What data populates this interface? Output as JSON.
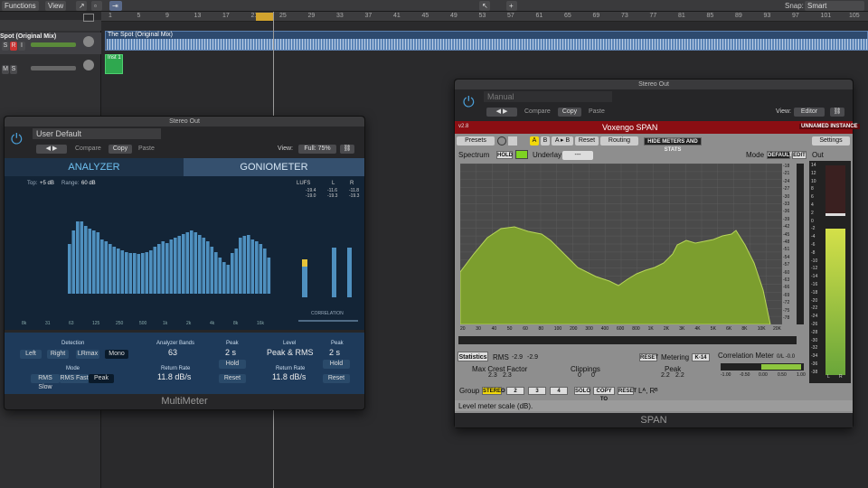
{
  "daw": {
    "menu_functions": "Functions",
    "menu_view": "View",
    "snap_label": "Snap:",
    "snap_value": "Smart",
    "ruler": [
      "1",
      "5",
      "9",
      "13",
      "17",
      "21",
      "25",
      "29",
      "33",
      "37",
      "41",
      "45",
      "49",
      "53",
      "57",
      "61",
      "65",
      "69",
      "73",
      "77",
      "81",
      "85",
      "89",
      "93",
      "97",
      "101",
      "105"
    ],
    "track1_name": "Spot (Original Mix)",
    "region1_label": "The Spot (Original Mix)",
    "region2_label": "Inst 1",
    "btn_s": "S",
    "btn_r": "R",
    "btn_i": "I",
    "btn_m": "M"
  },
  "multimeter": {
    "title": "Stereo Out",
    "preset": "User Default",
    "compare": "Compare",
    "copy": "Copy",
    "paste": "Paste",
    "view_label": "View:",
    "view_value": "Full: 75%",
    "tab_analyzer": "ANALYZER",
    "tab_goniometer": "GONIOMETER",
    "top_label": "Top:",
    "top_value": "+5 dB",
    "range_label": "Range:",
    "range_value": "60 dB",
    "lufs": "LUFS",
    "l": "L",
    "r": "R",
    "lufs_vals": "-19.4",
    "lufs_vals2": "-19.0",
    "l_peak": "-11.6",
    "l_rms": "-19.3",
    "r_peak": "-11.8",
    "r_rms": "-19.3",
    "peak_word": "Peak",
    "rms_word": "RMS",
    "correlation": "CORRELATION",
    "detection": "Detection",
    "det_left": "Left",
    "det_right": "Right",
    "det_lrmax": "LRmax",
    "det_mono": "Mono",
    "mode": "Mode",
    "mode_slow": "RMS Slow",
    "mode_fast": "RMS Fast",
    "mode_peak": "Peak",
    "bands_label": "Analyzer Bands",
    "bands_value": "63",
    "ret_label": "Return Rate",
    "ret_value": "11.8 dB/s",
    "peak_label": "Peak",
    "peak_value": "2 s",
    "hold": "Hold",
    "reset": "Reset",
    "level_label": "Level",
    "level_value": "Peak & RMS",
    "ret2_value": "11.8 dB/s",
    "peak2_value": "2 s",
    "footer": "MultiMeter",
    "freq_ticks": [
      "8k",
      "31",
      "63",
      "125",
      "250",
      "500",
      "1k",
      "2k",
      "4k",
      "8k",
      "16k"
    ]
  },
  "span": {
    "title": "Stereo Out",
    "preset": "Manual",
    "compare": "Compare",
    "copy": "Copy",
    "paste": "Paste",
    "view_label": "View:",
    "view_value": "Editor",
    "version": "v2.8",
    "name": "Voxengo SPAN",
    "instance": "UNNAMED INSTANCE",
    "presets": "Presets",
    "a": "A",
    "b": "B",
    "ab": "A ▸ B",
    "reset": "Reset",
    "routing": "Routing",
    "hide": "HIDE METERS AND STATS",
    "settings": "Settings",
    "spectrum": "Spectrum",
    "hold": "HOLD",
    "underlay": "Underlay",
    "underlay_val": "---",
    "mode": "Mode",
    "mode_default": "DEFAULT",
    "edit": "EDIT",
    "out": "Out",
    "db_scale": [
      "-18",
      "-21",
      "-24",
      "-27",
      "-30",
      "-33",
      "-36",
      "-39",
      "-42",
      "-45",
      "-48",
      "-51",
      "-54",
      "-57",
      "-60",
      "-63",
      "-66",
      "-69",
      "-72",
      "-75",
      "-78"
    ],
    "freq_scale": [
      "20",
      "30",
      "40",
      "50",
      "60",
      "80",
      "100",
      "200",
      "300",
      "400",
      "600",
      "800",
      "1K",
      "2K",
      "3K",
      "4K",
      "5K",
      "6K",
      "8K",
      "10K",
      "20K"
    ],
    "out_scale": [
      "14",
      "12",
      "10",
      "8",
      "6",
      "4",
      "2",
      "0",
      "-2",
      "-4",
      "-6",
      "-8",
      "-10",
      "-12",
      "-14",
      "-16",
      "-18",
      "-20",
      "-22",
      "-24",
      "-26",
      "-28",
      "-30",
      "-32",
      "-34",
      "-36",
      "-38"
    ],
    "statistics": "Statistics",
    "rms_label": "RMS",
    "rms_l": "-2.9",
    "rms_r": "-2.9",
    "crest_label": "Max Crest Factor",
    "crest_l": "2.3",
    "crest_r": "2.3",
    "clip_label": "Clippings",
    "clip_l": "0",
    "clip_r": "0",
    "reset_btn": "RESET",
    "metering": "Metering",
    "metering_val": "K-14",
    "peak_label": "Peak",
    "peak_l": "2.2",
    "peak_r": "2.2",
    "corr_label": "Correlation Meter",
    "corr_vals": "0/L  -0.0",
    "corr_ticks": [
      "-1.00",
      "-0.50",
      "0.00",
      "0.50",
      "1.00"
    ],
    "group": "Group",
    "stereo": "STEREO",
    "g2": "2",
    "g3": "3",
    "g4": "4",
    "solo": "SOLO",
    "copyto": "COPY TO",
    "greset": "RESET",
    "lr": "Lᴬ, Rᴮ",
    "status": "Level meter scale (dB).",
    "footer": "SPAN",
    "out_ticks": [
      "L",
      "R"
    ]
  },
  "colors": {
    "spectrum_fill": "#7c9e2e",
    "accent_red": "#8b0e13",
    "bar_blue": "#4f90bf"
  }
}
